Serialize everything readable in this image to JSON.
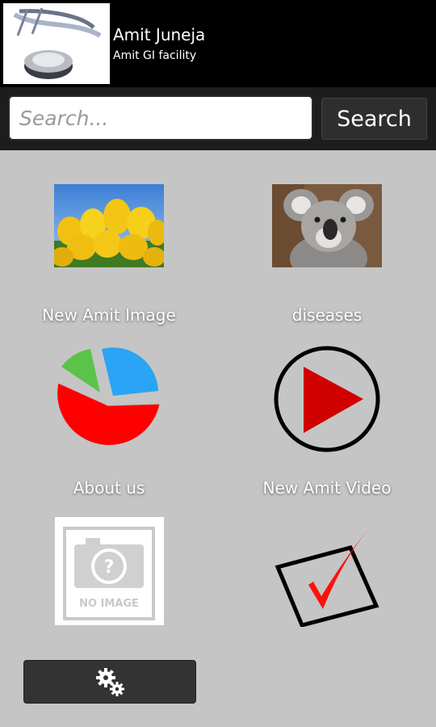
{
  "header": {
    "name": "Amit Juneja",
    "facility": "Amit GI facility",
    "logo_icon": "stethoscope-icon"
  },
  "search": {
    "placeholder": "Search...",
    "value": "",
    "button_label": "Search"
  },
  "tiles": [
    {
      "label": "New Amit Image",
      "icon": "tulips-image"
    },
    {
      "label": "diseases",
      "icon": "koala-image"
    },
    {
      "label": "About us",
      "icon": "pie-chart-icon"
    },
    {
      "label": "New Amit Video",
      "icon": "play-icon"
    },
    {
      "label": "",
      "icon": "no-image-placeholder"
    },
    {
      "label": "",
      "icon": "checkbox-checked-icon"
    }
  ],
  "settings": {
    "icon": "gears-icon"
  },
  "colors": {
    "background": "#c5c5c5",
    "header": "#000000",
    "accent_red": "#d10000"
  }
}
